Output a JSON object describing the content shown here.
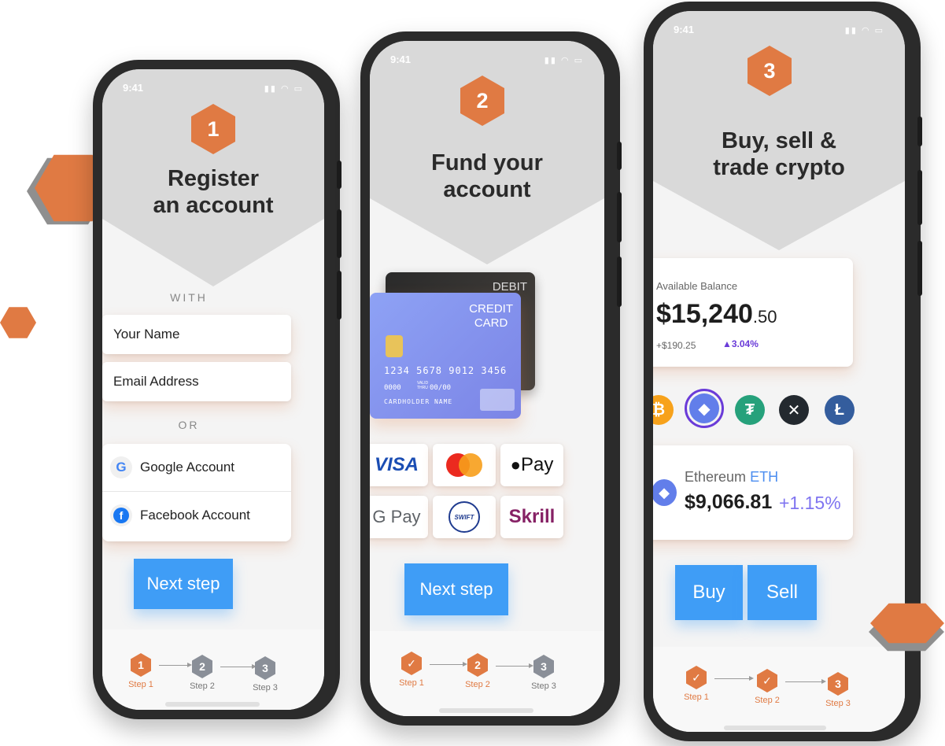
{
  "status": {
    "time": "9:41"
  },
  "phone1": {
    "step_number": "1",
    "title_line1": "Register",
    "title_line2": "an account",
    "with_label": "WITH",
    "name_placeholder": "Your Name",
    "email_placeholder": "Email Address",
    "or_label": "OR",
    "google_label": "Google Account",
    "facebook_label": "Facebook Account",
    "next_button": "Next step"
  },
  "phone2": {
    "step_number": "2",
    "title_line1": "Fund your",
    "title_line2": "account",
    "card": {
      "back_label": "DEBIT",
      "front_label_line1": "CREDIT",
      "front_label_line2": "CARD",
      "number": "1234 5678 9012 3456",
      "small_number": "0000",
      "valid_label": "VALID THRU",
      "expiry": "00/00",
      "holder": "CARDHOLDER NAME"
    },
    "payments": [
      "VISA",
      "Mastercard",
      "Pay",
      "G Pay",
      "SWIFT",
      "Skrill"
    ],
    "next_button": "Next step"
  },
  "phone3": {
    "step_number": "3",
    "title_line1": "Buy, sell &",
    "title_line2": "trade crypto",
    "balance_label": "Available Balance",
    "balance_main": "$15,240",
    "balance_cents": ".50",
    "change_amount": "+$190.25",
    "change_percent": "▲3.04%",
    "coins": [
      {
        "name": "bitcoin",
        "symbol": "₿",
        "color": "#f7a21b"
      },
      {
        "name": "ethereum",
        "symbol": "◆",
        "color": "#627eea"
      },
      {
        "name": "tether",
        "symbol": "₮",
        "color": "#26a17b"
      },
      {
        "name": "xrp",
        "symbol": "✕",
        "color": "#23292f"
      },
      {
        "name": "litecoin",
        "symbol": "Ł",
        "color": "#345d9d"
      }
    ],
    "asset_name": "Ethereum",
    "asset_ticker": "ETH",
    "asset_price": "$9,066.81",
    "asset_change": "+1.15%",
    "buy_button": "Buy",
    "sell_button": "Sell"
  },
  "stepper": {
    "step1": "Step 1",
    "step2": "Step 2",
    "step3": "Step 3",
    "n1": "1",
    "n2": "2",
    "n3": "3",
    "check": "✓"
  },
  "colors": {
    "accent": "#e07a43",
    "button": "#3f9df6",
    "purple": "#6a3bd8"
  }
}
